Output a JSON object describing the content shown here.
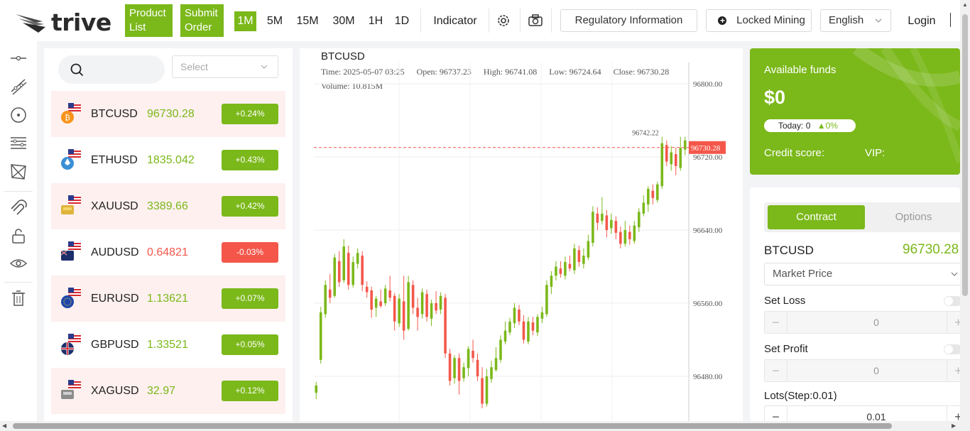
{
  "header": {
    "brand": "trive",
    "product_list_label": "Product List",
    "submit_order_label": "Submit Order",
    "timeframes": [
      "1M",
      "5M",
      "15M",
      "30M",
      "1H",
      "1D"
    ],
    "active_timeframe": "1M",
    "indicator_label": "Indicator",
    "regulatory_label": "Regulatory Information",
    "locked_mining_label": "Locked Mining",
    "language_label": "English",
    "login_label": "Login"
  },
  "watchlist": {
    "select_placeholder": "Select",
    "items": [
      {
        "symbol": "BTCUSD",
        "price": "96730.28",
        "change": "+0.24%",
        "direction": "up",
        "flag": "bitcoin"
      },
      {
        "symbol": "ETHUSD",
        "price": "1835.042",
        "change": "+0.43%",
        "direction": "up",
        "flag": "ethereum"
      },
      {
        "symbol": "XAUUSD",
        "price": "3389.66",
        "change": "+0.42%",
        "direction": "up",
        "flag": "gold"
      },
      {
        "symbol": "AUDUSD",
        "price": "0.64821",
        "change": "-0.03%",
        "direction": "down",
        "flag": "australia"
      },
      {
        "symbol": "EURUSD",
        "price": "1.13621",
        "change": "+0.07%",
        "direction": "up",
        "flag": "eu"
      },
      {
        "symbol": "GBPUSD",
        "price": "1.33521",
        "change": "+0.05%",
        "direction": "up",
        "flag": "uk"
      },
      {
        "symbol": "XAGUSD",
        "price": "32.97",
        "change": "+0.12%",
        "direction": "up",
        "flag": "silver"
      }
    ]
  },
  "chart": {
    "symbol": "BTCUSD",
    "time": "Time: 2025-05-07 03:25",
    "open": "Open: 96737.23",
    "high": "High: 96741.08",
    "low": "Low: 96724.64",
    "close": "Close: 96730.28",
    "volume": "Volume: 10.815M",
    "current_price_label": "96730.28",
    "high_marker": "96742.22"
  },
  "chart_data": {
    "type": "candlestick",
    "y_ticks": [
      96800,
      96720,
      96640,
      96560,
      96480
    ],
    "y_tick_labels": [
      "96800.00",
      "96720.00",
      "96640.00",
      "96560.00",
      "96480.00"
    ],
    "last_price": 96730.28,
    "high_annotation": 96742.22,
    "candles": [
      {
        "o": 96462,
        "c": 96470,
        "h": 96474,
        "l": 96455
      },
      {
        "o": 96498,
        "c": 96550,
        "h": 96556,
        "l": 96494
      },
      {
        "o": 96548,
        "c": 96580,
        "h": 96585,
        "l": 96544
      },
      {
        "o": 96575,
        "c": 96566,
        "h": 96592,
        "l": 96560
      },
      {
        "o": 96568,
        "c": 96610,
        "h": 96614,
        "l": 96566
      },
      {
        "o": 96606,
        "c": 96583,
        "h": 96617,
        "l": 96578
      },
      {
        "o": 96585,
        "c": 96622,
        "h": 96630,
        "l": 96582
      },
      {
        "o": 96615,
        "c": 96580,
        "h": 96623,
        "l": 96575
      },
      {
        "o": 96580,
        "c": 96605,
        "h": 96611,
        "l": 96577
      },
      {
        "o": 96603,
        "c": 96615,
        "h": 96620,
        "l": 96598
      },
      {
        "o": 96612,
        "c": 96580,
        "h": 96617,
        "l": 96573
      },
      {
        "o": 96578,
        "c": 96572,
        "h": 96584,
        "l": 96566
      },
      {
        "o": 96574,
        "c": 96553,
        "h": 96578,
        "l": 96544
      },
      {
        "o": 96555,
        "c": 96565,
        "h": 96568,
        "l": 96545
      },
      {
        "o": 96562,
        "c": 96557,
        "h": 96575,
        "l": 96555
      },
      {
        "o": 96560,
        "c": 96576,
        "h": 96580,
        "l": 96557
      },
      {
        "o": 96574,
        "c": 96566,
        "h": 96590,
        "l": 96562
      },
      {
        "o": 96568,
        "c": 96540,
        "h": 96571,
        "l": 96530
      },
      {
        "o": 96538,
        "c": 96565,
        "h": 96570,
        "l": 96534
      },
      {
        "o": 96562,
        "c": 96530,
        "h": 96590,
        "l": 96520
      },
      {
        "o": 96532,
        "c": 96583,
        "h": 96590,
        "l": 96530
      },
      {
        "o": 96580,
        "c": 96555,
        "h": 96585,
        "l": 96548
      },
      {
        "o": 96555,
        "c": 96545,
        "h": 96566,
        "l": 96530
      },
      {
        "o": 96548,
        "c": 96572,
        "h": 96576,
        "l": 96543
      },
      {
        "o": 96570,
        "c": 96545,
        "h": 96575,
        "l": 96540
      },
      {
        "o": 96543,
        "c": 96560,
        "h": 96564,
        "l": 96535
      },
      {
        "o": 96560,
        "c": 96552,
        "h": 96573,
        "l": 96548
      },
      {
        "o": 96553,
        "c": 96568,
        "h": 96572,
        "l": 96548
      },
      {
        "o": 96566,
        "c": 96505,
        "h": 96570,
        "l": 96500
      },
      {
        "o": 96505,
        "c": 96475,
        "h": 96510,
        "l": 96470
      },
      {
        "o": 96478,
        "c": 96500,
        "h": 96503,
        "l": 96472
      },
      {
        "o": 96500,
        "c": 96475,
        "h": 96505,
        "l": 96460
      },
      {
        "o": 96478,
        "c": 96490,
        "h": 96495,
        "l": 96474
      },
      {
        "o": 96489,
        "c": 96510,
        "h": 96513,
        "l": 96480
      },
      {
        "o": 96508,
        "c": 96500,
        "h": 96520,
        "l": 96495
      },
      {
        "o": 96498,
        "c": 96480,
        "h": 96505,
        "l": 96475
      },
      {
        "o": 96478,
        "c": 96450,
        "h": 96490,
        "l": 96445
      },
      {
        "o": 96450,
        "c": 96480,
        "h": 96488,
        "l": 96447
      },
      {
        "o": 96477,
        "c": 96490,
        "h": 96497,
        "l": 96473
      },
      {
        "o": 96487,
        "c": 96500,
        "h": 96512,
        "l": 96485
      },
      {
        "o": 96498,
        "c": 96520,
        "h": 96525,
        "l": 96495
      },
      {
        "o": 96518,
        "c": 96530,
        "h": 96540,
        "l": 96515
      },
      {
        "o": 96528,
        "c": 96540,
        "h": 96544,
        "l": 96525
      },
      {
        "o": 96538,
        "c": 96555,
        "h": 96560,
        "l": 96533
      },
      {
        "o": 96553,
        "c": 96540,
        "h": 96558,
        "l": 96536
      },
      {
        "o": 96540,
        "c": 96520,
        "h": 96547,
        "l": 96516
      },
      {
        "o": 96518,
        "c": 96540,
        "h": 96545,
        "l": 96515
      },
      {
        "o": 96539,
        "c": 96530,
        "h": 96545,
        "l": 96525
      },
      {
        "o": 96528,
        "c": 96545,
        "h": 96548,
        "l": 96524
      },
      {
        "o": 96543,
        "c": 96550,
        "h": 96556,
        "l": 96538
      },
      {
        "o": 96548,
        "c": 96580,
        "h": 96585,
        "l": 96545
      },
      {
        "o": 96578,
        "c": 96590,
        "h": 96595,
        "l": 96570
      },
      {
        "o": 96590,
        "c": 96600,
        "h": 96606,
        "l": 96585
      },
      {
        "o": 96598,
        "c": 96592,
        "h": 96606,
        "l": 96588
      },
      {
        "o": 96590,
        "c": 96605,
        "h": 96611,
        "l": 96586
      },
      {
        "o": 96603,
        "c": 96598,
        "h": 96612,
        "l": 96595
      },
      {
        "o": 96596,
        "c": 96620,
        "h": 96625,
        "l": 96592
      },
      {
        "o": 96618,
        "c": 96605,
        "h": 96623,
        "l": 96600
      },
      {
        "o": 96603,
        "c": 96612,
        "h": 96620,
        "l": 96598
      },
      {
        "o": 96610,
        "c": 96628,
        "h": 96635,
        "l": 96607
      },
      {
        "o": 96626,
        "c": 96660,
        "h": 96666,
        "l": 96622
      },
      {
        "o": 96658,
        "c": 96648,
        "h": 96665,
        "l": 96640
      },
      {
        "o": 96650,
        "c": 96658,
        "h": 96676,
        "l": 96646
      },
      {
        "o": 96656,
        "c": 96640,
        "h": 96662,
        "l": 96632
      },
      {
        "o": 96642,
        "c": 96651,
        "h": 96658,
        "l": 96636
      },
      {
        "o": 96650,
        "c": 96637,
        "h": 96655,
        "l": 96630
      },
      {
        "o": 96638,
        "c": 96625,
        "h": 96644,
        "l": 96620
      },
      {
        "o": 96625,
        "c": 96640,
        "h": 96650,
        "l": 96622
      },
      {
        "o": 96638,
        "c": 96630,
        "h": 96645,
        "l": 96624
      },
      {
        "o": 96628,
        "c": 96645,
        "h": 96650,
        "l": 96625
      },
      {
        "o": 96643,
        "c": 96660,
        "h": 96664,
        "l": 96638
      },
      {
        "o": 96658,
        "c": 96670,
        "h": 96678,
        "l": 96655
      },
      {
        "o": 96668,
        "c": 96685,
        "h": 96688,
        "l": 96660
      },
      {
        "o": 96683,
        "c": 96675,
        "h": 96690,
        "l": 96668
      },
      {
        "o": 96673,
        "c": 96690,
        "h": 96693,
        "l": 96670
      },
      {
        "o": 96688,
        "c": 96735,
        "h": 96742,
        "l": 96685
      },
      {
        "o": 96733,
        "c": 96715,
        "h": 96738,
        "l": 96710
      },
      {
        "o": 96712,
        "c": 96725,
        "h": 96732,
        "l": 96705
      },
      {
        "o": 96723,
        "c": 96710,
        "h": 96730,
        "l": 96700
      },
      {
        "o": 96708,
        "c": 96730,
        "h": 96742,
        "l": 96705
      },
      {
        "o": 96728,
        "c": 96738,
        "h": 96742,
        "l": 96722
      }
    ]
  },
  "account": {
    "funds_label": "Available funds",
    "funds_amount": "$0",
    "today_label": "Today: 0",
    "today_change": "0%",
    "credit_label": "Credit score:",
    "vip_label": "VIP:"
  },
  "trade": {
    "tab_contract": "Contract",
    "tab_options": "Options",
    "symbol": "BTCUSD",
    "price": "96730.28",
    "order_type": "Market Price",
    "set_loss_label": "Set Loss",
    "set_loss_value": "0",
    "set_profit_label": "Set Profit",
    "set_profit_value": "0",
    "lots_label": "Lots(Step:0.01)",
    "lots_value": "0.01"
  },
  "colors": {
    "up": "#7bb81a",
    "down": "#f4574a",
    "accent": "#7bb81a"
  }
}
